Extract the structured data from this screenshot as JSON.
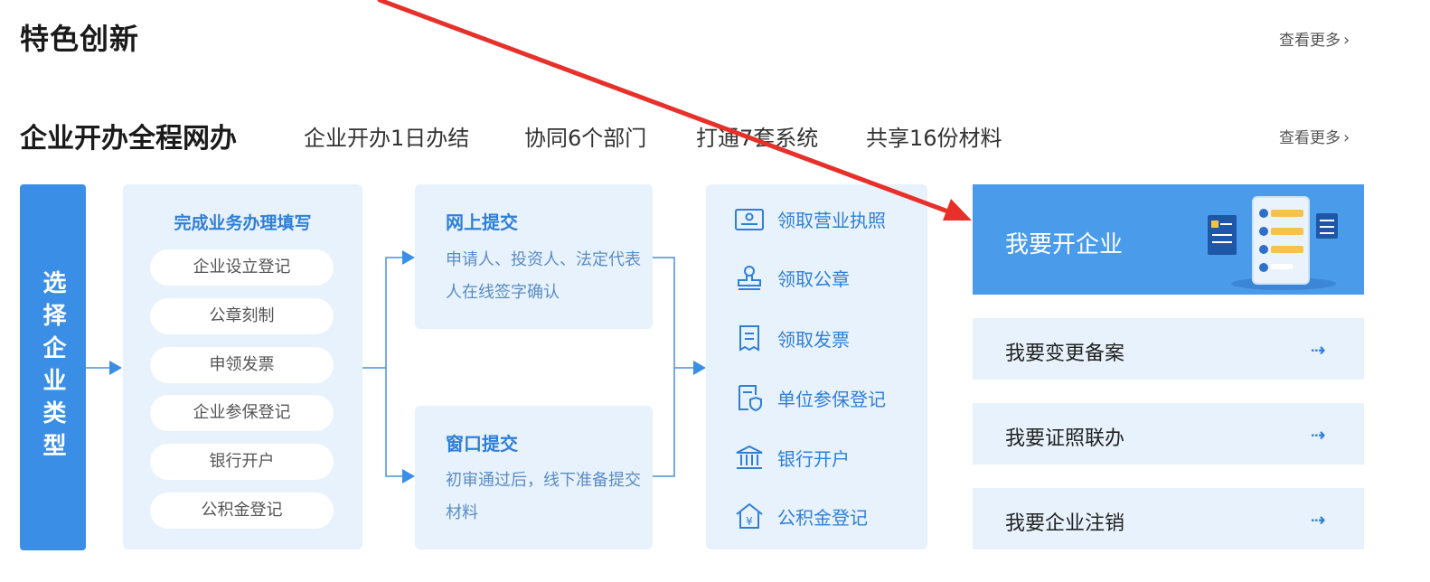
{
  "section1": {
    "title": "特色创新",
    "more": "查看更多"
  },
  "section2": {
    "title": "企业开办全程网办",
    "tags": [
      "企业开办1日办结",
      "协同6个部门",
      "打通7套系统",
      "共享16份材料"
    ],
    "more": "查看更多"
  },
  "flow": {
    "select_type": "选择企业类型",
    "fill_title": "完成业务办理填写",
    "fill_items": [
      "企业设立登记",
      "公章刻制",
      "申领发票",
      "企业参保登记",
      "银行开户",
      "公积金登记"
    ],
    "online": {
      "title": "网上提交",
      "desc": "申请人、投资人、法定代表人在线签字确认"
    },
    "window": {
      "title": "窗口提交",
      "desc": "初审通过后，线下准备提交材料"
    },
    "receive": [
      {
        "label": "领取营业执照",
        "icon": "license-icon"
      },
      {
        "label": "领取公章",
        "icon": "seal-icon"
      },
      {
        "label": "领取发票",
        "icon": "receipt-icon"
      },
      {
        "label": "单位参保登记",
        "icon": "insurance-icon"
      },
      {
        "label": "银行开户",
        "icon": "bank-icon"
      },
      {
        "label": "公积金登记",
        "icon": "housing-fund-icon"
      }
    ]
  },
  "actions": {
    "main": "我要开企业",
    "items": [
      "我要变更备案",
      "我要证照联办",
      "我要企业注销"
    ],
    "arrow": "⇢"
  },
  "colors": {
    "accent": "#3a8ee6",
    "panel": "#e8f2fc",
    "annotation_arrow": "#e8302a"
  }
}
